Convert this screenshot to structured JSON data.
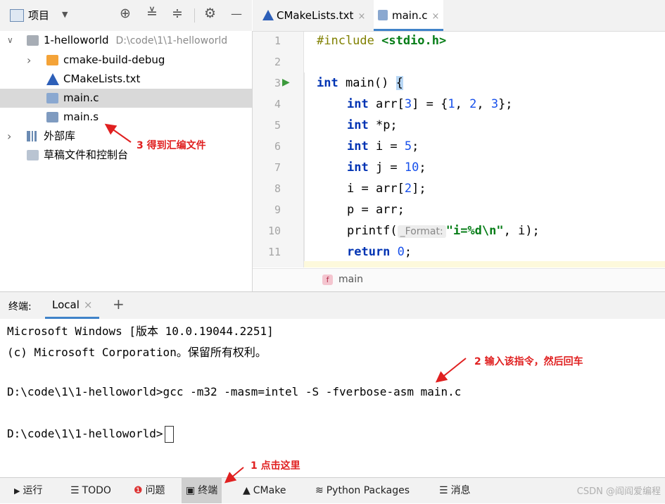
{
  "project_panel": {
    "title": "项目",
    "dropdown": "▼",
    "toolbar_icons": [
      "⊕",
      "≚",
      "≑",
      "⚙",
      "—"
    ],
    "tree": [
      {
        "label": "1-helloworld",
        "path": "D:\\code\\1\\1-helloworld",
        "arrow": "∨",
        "icon": "folder-icon"
      },
      {
        "label": "cmake-build-debug",
        "arrow": "›",
        "icon": "folder-orange-icon"
      },
      {
        "label": "CMakeLists.txt",
        "icon": "cmake-icon"
      },
      {
        "label": "main.c",
        "icon": "c-file-icon"
      },
      {
        "label": "main.s",
        "icon": "asm-file-icon"
      },
      {
        "label": "外部库",
        "arrow": "›",
        "icon": "library-icon"
      },
      {
        "label": "草稿文件和控制台",
        "icon": "scratch-icon"
      }
    ]
  },
  "editor": {
    "tabs": [
      {
        "label": "CMakeLists.txt",
        "close": "×"
      },
      {
        "label": "main.c",
        "close": "×"
      }
    ],
    "line_numbers": [
      "1",
      "2",
      "3",
      "4",
      "5",
      "6",
      "7",
      "8",
      "9",
      "10",
      "11"
    ],
    "run_marker": "▶",
    "code": {
      "l1_a": "#include",
      "l1_b": " <stdio.h>",
      "l3_a": "int",
      "l3_b": " main() ",
      "l3_c": "{",
      "l4_a": "int",
      "l4_b": " arr[",
      "l4_c": "3",
      "l4_d": "] = {",
      "l4_e": "1",
      "l4_f": ", ",
      "l4_g": "2",
      "l4_h": ", ",
      "l4_i": "3",
      "l4_j": "};",
      "l5_a": "int",
      "l5_b": " *p;",
      "l6_a": "int",
      "l6_b": " i = ",
      "l6_c": "5",
      "l6_d": ";",
      "l7_a": "int",
      "l7_b": " j = ",
      "l7_c": "10",
      "l7_d": ";",
      "l8_a": "i = arr[",
      "l8_b": "2",
      "l8_c": "];",
      "l9": "p = arr;",
      "l10_a": "printf(",
      "l10_hint": "_Format:",
      "l10_str": "\"i=%d\\n\"",
      "l10_b": ", i);",
      "l11_a": "return",
      "l11_b": " 0",
      "l11_c": ";"
    },
    "breadcrumb_icon": "f",
    "breadcrumb": "main"
  },
  "terminal": {
    "label": "终端:",
    "tab": "Local",
    "tab_close": "×",
    "add": "+",
    "lines": [
      "Microsoft Windows [版本 10.0.19044.2251]",
      "(c) Microsoft Corporation。保留所有权利。",
      "",
      "D:\\code\\1\\1-helloworld>gcc -m32 -masm=intel -S -fverbose-asm main.c",
      "",
      "D:\\code\\1\\1-helloworld>"
    ]
  },
  "bottom_bar": [
    {
      "icon": "▶",
      "label": "运行"
    },
    {
      "icon": "☰",
      "label": "TODO"
    },
    {
      "icon": "❶",
      "label": "问题"
    },
    {
      "icon": "▣",
      "label": "终端"
    },
    {
      "icon": "▲",
      "label": "CMake"
    },
    {
      "icon": "≋",
      "label": "Python Packages"
    },
    {
      "icon": "☰",
      "label": "消息"
    }
  ],
  "annotations": {
    "a1": "1 点击这里",
    "a2": "2 输入该指令，然后回车",
    "a3": "3 得到汇编文件"
  },
  "watermark": "CSDN @阎阎爱编程",
  "colors": {
    "annotation": "#e02020",
    "keyword": "#0033b3",
    "string": "#067d17",
    "number": "#1750eb",
    "accent": "#4083c9"
  }
}
